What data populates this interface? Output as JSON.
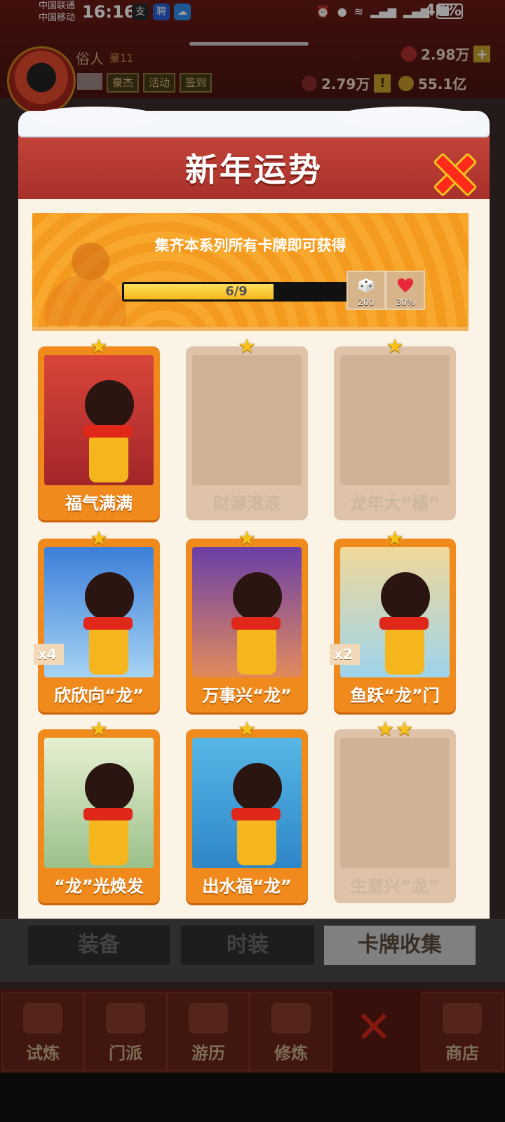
{
  "status_bar": {
    "carrier_1": "中国联通",
    "carrier_2": "中国移动",
    "time": "16:16",
    "app_badge_1": "支",
    "app_badge_2": "聘",
    "battery": "46%"
  },
  "player": {
    "name": "俗人",
    "rank": "豪11",
    "chips": [
      "豪杰",
      "活动",
      "签到"
    ],
    "gem_amount": "2.98万",
    "cards_amount": "2.79万",
    "coins_amount": "55.1亿"
  },
  "modal": {
    "title": "新年运势",
    "banner_text": "集齐本系列所有卡牌即可获得",
    "progress": {
      "current": 6,
      "total": 9,
      "label": "6/9"
    },
    "rewards": [
      {
        "icon": "dice-icon",
        "amount": "200"
      },
      {
        "icon": "heart-icon",
        "amount": "30%"
      }
    ],
    "cards": [
      {
        "name": "福气满满",
        "stars": 1,
        "owned": true,
        "art": "art-red",
        "dup": ""
      },
      {
        "name": "财源滚滚",
        "stars": 1,
        "owned": false,
        "art": "",
        "dup": ""
      },
      {
        "name": "龙年大“橘”",
        "stars": 1,
        "owned": false,
        "art": "",
        "dup": ""
      },
      {
        "name": "欣欣向“龙”",
        "stars": 1,
        "owned": true,
        "art": "art-sky",
        "dup": "x4"
      },
      {
        "name": "万事兴“龙”",
        "stars": 1,
        "owned": true,
        "art": "art-dusk",
        "dup": ""
      },
      {
        "name": "鱼跃“龙”门",
        "stars": 1,
        "owned": true,
        "art": "art-gate",
        "dup": "x2"
      },
      {
        "name": "“龙”光焕发",
        "stars": 1,
        "owned": true,
        "art": "art-bamboo",
        "dup": ""
      },
      {
        "name": "出水福“龙”",
        "stars": 1,
        "owned": true,
        "art": "art-water",
        "dup": ""
      },
      {
        "name": "生意兴“龙”",
        "stars": 2,
        "owned": false,
        "art": "",
        "dup": ""
      }
    ]
  },
  "tabs": [
    "装备",
    "时装",
    "卡牌收集"
  ],
  "bottom_nav": [
    "试炼",
    "门派",
    "游历",
    "修炼",
    "",
    "商店"
  ],
  "colors": {
    "accent": "#f08a1c",
    "header_red": "#b83a30",
    "close_red": "#ff2a1a"
  }
}
